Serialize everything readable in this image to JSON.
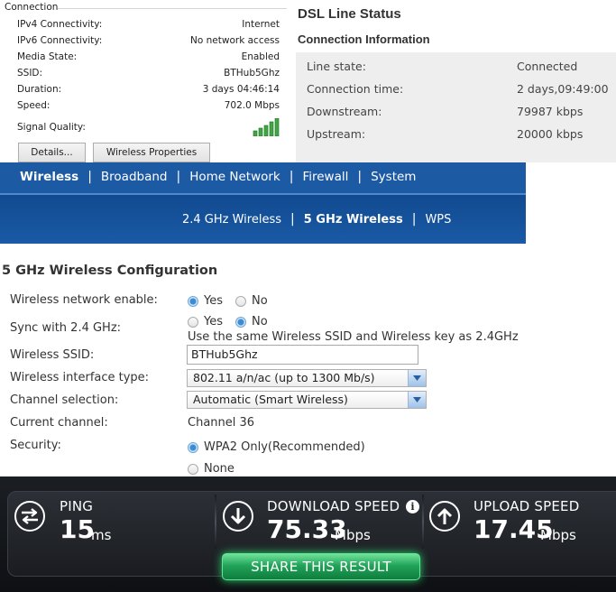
{
  "connection_status": {
    "group_label": "Connection",
    "rows": [
      {
        "label": "IPv4 Connectivity:",
        "value": "Internet"
      },
      {
        "label": "IPv6 Connectivity:",
        "value": "No network access"
      },
      {
        "label": "Media State:",
        "value": "Enabled"
      },
      {
        "label": "SSID:",
        "value": "BTHub5Ghz"
      },
      {
        "label": "Duration:",
        "value": "3 days 04:46:14"
      },
      {
        "label": "Speed:",
        "value": "702.0 Mbps"
      }
    ],
    "signal_label": "Signal Quality:",
    "signal_bars": 5,
    "details_button": "Details...",
    "wireless_properties_button": "Wireless Properties"
  },
  "dsl": {
    "title": "DSL Line Status",
    "subtitle": "Connection Information",
    "rows": [
      {
        "label": "Line state:",
        "value": "Connected"
      },
      {
        "label": "Connection time:",
        "value": "2 days,09:49:00"
      },
      {
        "label": "Downstream:",
        "value": "79987 kbps"
      },
      {
        "label": "Upstream:",
        "value": "20000 kbps"
      }
    ]
  },
  "router_nav": {
    "main": [
      "Wireless",
      "Broadband",
      "Home Network",
      "Firewall",
      "System"
    ],
    "sub": [
      "2.4 GHz Wireless",
      "5 GHz Wireless",
      "WPS"
    ],
    "colors": {
      "nav_bg": "#1d5aa4",
      "text": "#ffffff"
    }
  },
  "wireless_config": {
    "title": "5 GHz Wireless Configuration",
    "enable_label": "Wireless network enable:",
    "enable_yes": "Yes",
    "enable_no": "No",
    "sync_label": "Sync with 2.4 GHz:",
    "sync_yes": "Yes",
    "sync_no": "No",
    "sync_note": "Use the same Wireless SSID and Wireless key as 2.4GHz",
    "ssid_label": "Wireless SSID:",
    "ssid_value": "BTHub5Ghz",
    "interface_label": "Wireless interface type:",
    "interface_value": "802.11 a/n/ac (up to 1300 Mb/s)",
    "channel_label": "Channel selection:",
    "channel_value": "Automatic (Smart Wireless)",
    "current_channel_label": "Current channel:",
    "current_channel_value": "Channel 36",
    "security_label": "Security:",
    "security_wpa2": "WPA2 Only(Recommended)",
    "security_none": "None"
  },
  "speedtest": {
    "ping_label": "PING",
    "ping_value": "15",
    "ping_unit": "ms",
    "download_label": "DOWNLOAD SPEED",
    "download_value": "75.33",
    "download_unit": "Mbps",
    "upload_label": "UPLOAD SPEED",
    "upload_value": "17.45",
    "upload_unit": "Mbps",
    "info_glyph": "i",
    "share_button": "SHARE THIS RESULT",
    "colors": {
      "share": "#22a35a",
      "bg": "#1a1c20"
    }
  }
}
